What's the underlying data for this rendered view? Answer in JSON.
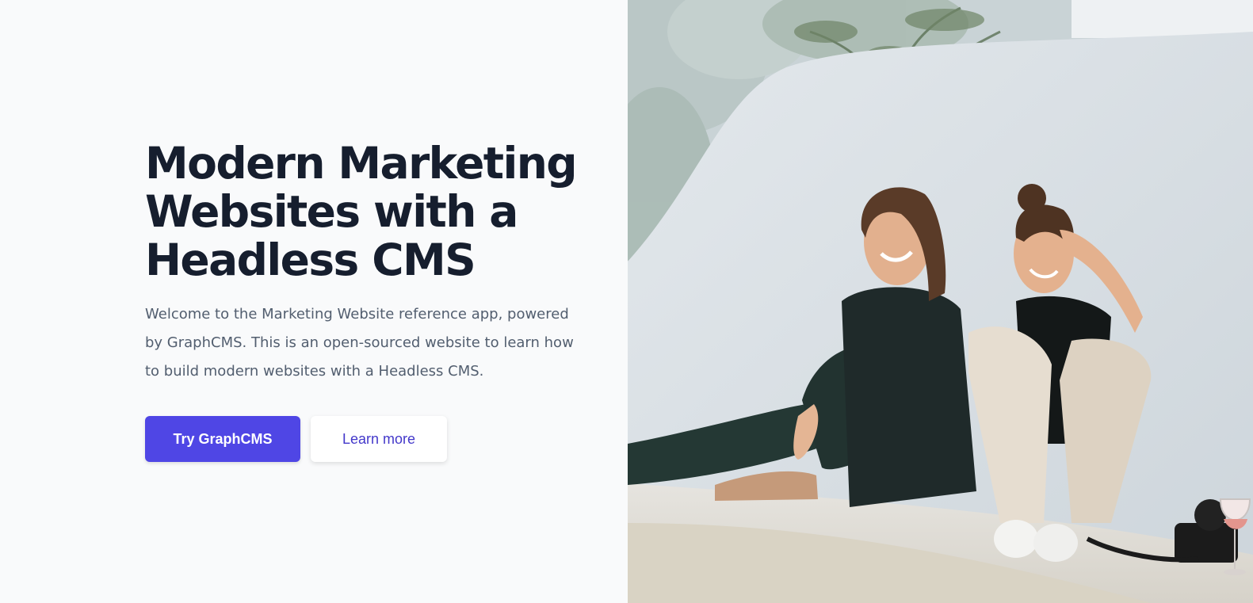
{
  "hero": {
    "title_line1": "Modern Marketing",
    "title_line2": "Websites with a",
    "title_line3": "Headless CMS",
    "description": "Welcome to the Marketing Website reference app, powered by GraphCMS. This is an open-sourced website to learn how to build modern websites with a Headless CMS.",
    "primary_button": "Try GraphCMS",
    "secondary_button": "Learn more"
  },
  "colors": {
    "primary": "#4f46e5",
    "heading": "#161e2e",
    "body_text": "#525e6f",
    "background": "#f9fafb"
  },
  "image": {
    "subject": "two-women-laughing-photo"
  }
}
